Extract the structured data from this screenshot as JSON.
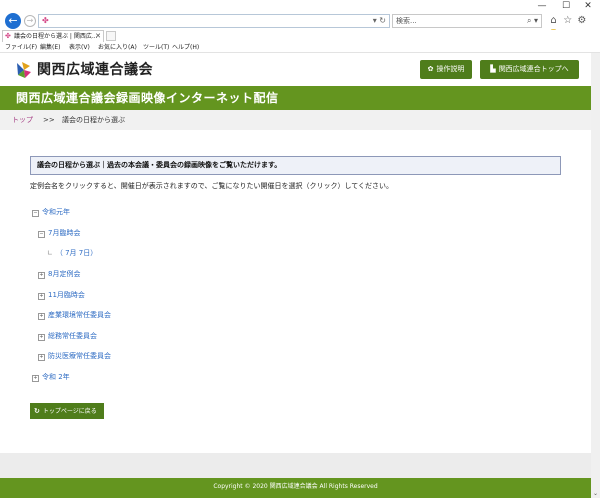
{
  "browser": {
    "window_controls": {
      "minimize": "—",
      "maximize": "☐",
      "close": "✕"
    },
    "address_value": "",
    "search_placeholder": "検索...",
    "search_glyph": "⌕ ▾",
    "address_glyph": "▾ ↻",
    "toolbar_icons": [
      "⌂",
      "☆",
      "⚙",
      "☺"
    ],
    "tab_label": "議会の日程から選ぶ | 関西広...",
    "menu": [
      "ファイル(F)",
      "編集(E)",
      "表示(V)",
      "お気に入り(A)",
      "ツール(T)",
      "ヘルプ(H)"
    ]
  },
  "site": {
    "logo_text": "関西広域連合議会",
    "buttons": {
      "help": "操作説明",
      "top": "関西広域連合トップへ"
    },
    "banner_title": "関西広域連合議会録画映像インターネット配信",
    "breadcrumb": {
      "top": "トップ",
      "sep": ">>",
      "current": "議会の日程から選ぶ"
    },
    "notice": "議会の日程から選ぶ｜過去の本会議・委員会の録画映像をご覧いただけます。",
    "instruction": "定例会名をクリックすると、開催日が表示されますので、ご覧になりたい開催日を選択（クリック）してください。",
    "tree": [
      {
        "label": "令和元年",
        "toggle": "−",
        "level": 0
      },
      {
        "label": "7月臨時会",
        "toggle": "−",
        "level": 1
      },
      {
        "label": "（ 7月 7日）",
        "toggle": "",
        "level": 2
      },
      {
        "label": "8月定例会",
        "toggle": "+",
        "level": 1
      },
      {
        "label": "11月臨時会",
        "toggle": "+",
        "level": 1
      },
      {
        "label": "産業環境常任委員会",
        "toggle": "+",
        "level": 1
      },
      {
        "label": "総務常任委員会",
        "toggle": "+",
        "level": 1
      },
      {
        "label": "防災医療常任委員会",
        "toggle": "+",
        "level": 1
      },
      {
        "label": "令和 2年",
        "toggle": "+",
        "level": 0
      }
    ],
    "back_button": "トップページに戻る",
    "footer": "Copyright © 2020 関西広域連合議会 All Rights Reserved"
  },
  "colors": {
    "brand_green": "#64951f",
    "button_green": "#4f7d1b",
    "link_blue": "#2d6bc3",
    "crumb_pink": "#a33a82"
  }
}
